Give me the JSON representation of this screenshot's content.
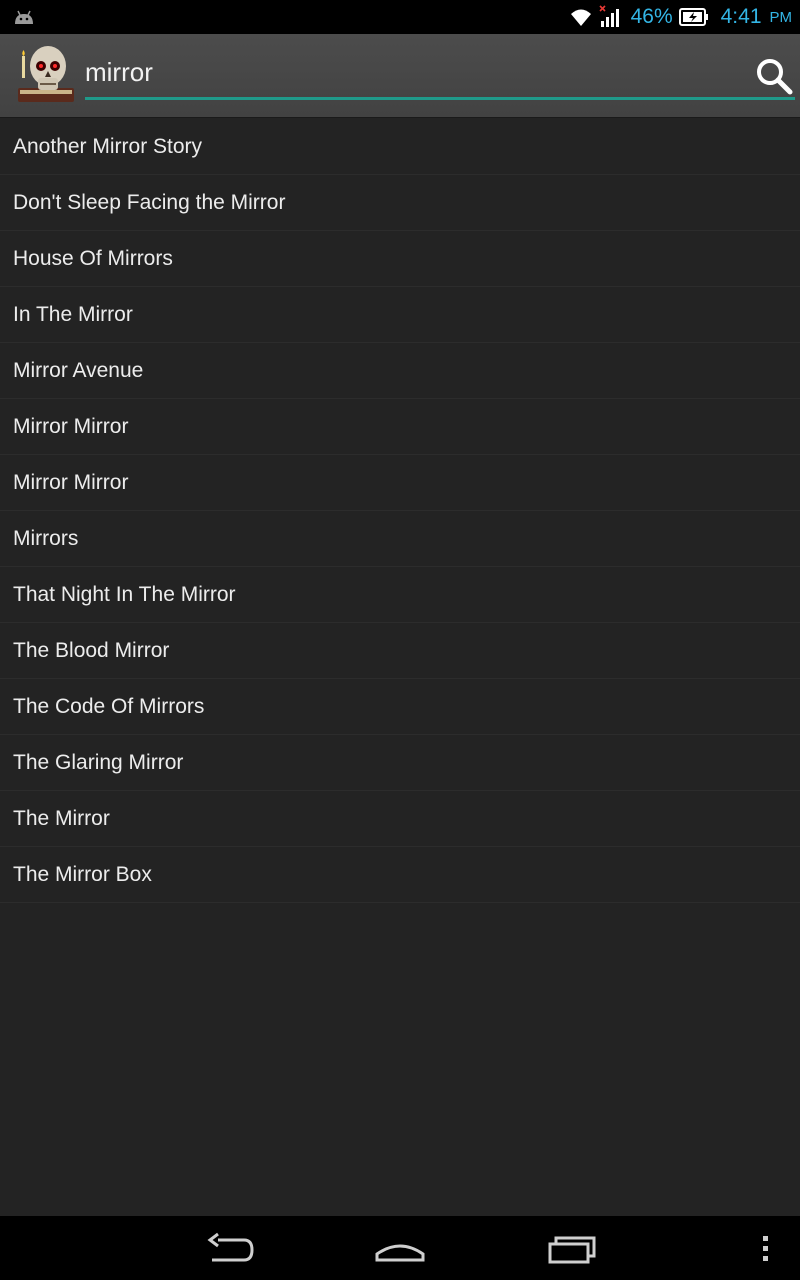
{
  "status_bar": {
    "battery_percent": "46%",
    "time": "4:41",
    "ampm": "PM",
    "icons": [
      "android-notification-icon",
      "wifi-icon",
      "signal-icon",
      "battery-charging-icon"
    ],
    "accent_color": "#33b5e5"
  },
  "action_bar": {
    "app_icon": "skull-book-icon",
    "search_query": "mirror",
    "search_icon": "search-icon",
    "underline_color": "#1f9a8a"
  },
  "results": [
    "Another Mirror Story",
    "Don't Sleep Facing the Mirror",
    "House Of Mirrors",
    "In The Mirror",
    "Mirror Avenue",
    "Mirror Mirror",
    "Mirror Mirror",
    "Mirrors",
    "That Night In The Mirror",
    "The Blood Mirror",
    "The Code Of Mirrors",
    "The Glaring Mirror",
    "The Mirror",
    "The Mirror Box"
  ],
  "nav_bar": {
    "buttons": [
      "back-icon",
      "home-icon",
      "recents-icon",
      "overflow-menu-icon"
    ]
  }
}
